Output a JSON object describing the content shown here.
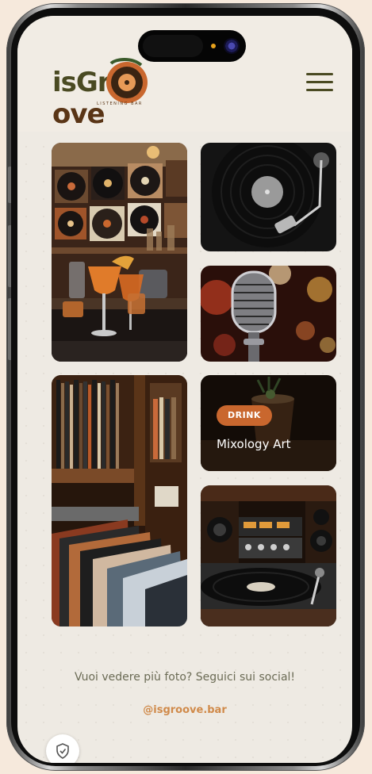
{
  "brand": {
    "logo_text_a": "isGr",
    "logo_text_b": "ove",
    "logo_sub": "LISTENING BAR"
  },
  "header": {
    "menu_icon": "hamburger-menu-icon"
  },
  "gallery": {
    "drink_tile": {
      "badge": "DRINK",
      "caption": "Mixology Art"
    }
  },
  "footer": {
    "social_text": "Vuoi vedere più foto? Seguici sui social!",
    "social_handle": "@isgroove.bar"
  },
  "colors": {
    "accent": "#c9672e",
    "brand_olive": "#4a4a22",
    "brand_brown": "#5a3516",
    "background": "#eeeae3"
  }
}
